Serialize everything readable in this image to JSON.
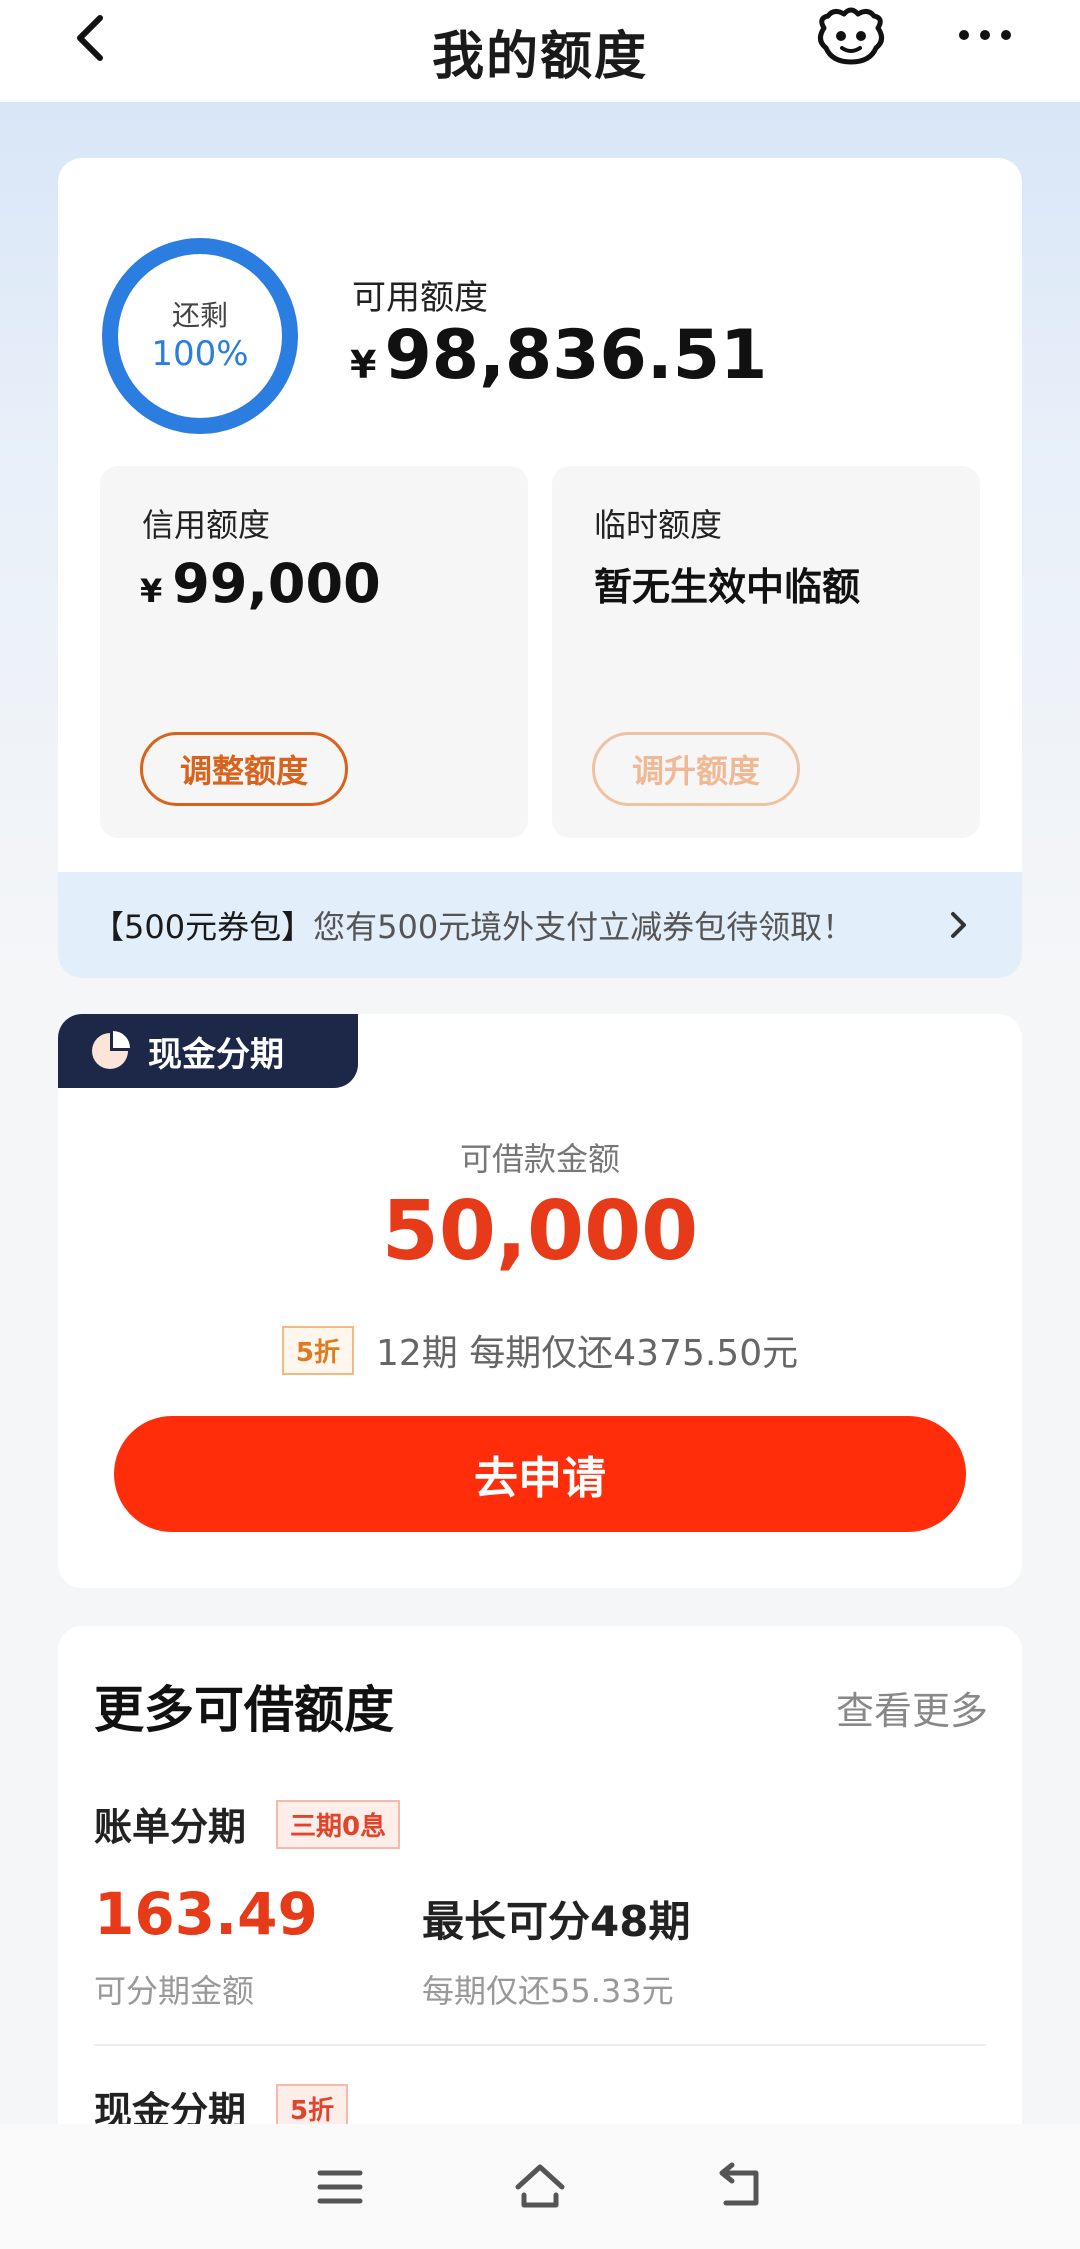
{
  "header": {
    "title": "我的额度"
  },
  "quota": {
    "ring_label": "还剩",
    "ring_value": "100%",
    "remaining_fraction": 1.0,
    "available_label": "可用额度",
    "currency": "¥",
    "available_amount": "98,836.51",
    "credit": {
      "label": "信用额度",
      "amount": "99,000",
      "button": "调整额度"
    },
    "temporary": {
      "label": "临时额度",
      "note": "暂无生效中临额",
      "button": "调升额度"
    },
    "promo": {
      "bold": "【500元券包】",
      "text": "您有500元境外支付立减券包待领取！"
    }
  },
  "cash_installment": {
    "tab_label": "现金分期",
    "loan_label": "可借款金额",
    "loan_amount": "50,000",
    "discount_badge": "5折",
    "plan_text": "12期  每期仅还4375.50元",
    "apply_button": "去申请"
  },
  "more_quota": {
    "title": "更多可借额度",
    "view_more": "查看更多",
    "items": [
      {
        "title": "账单分期",
        "tag": "三期0息",
        "amount": "163.49",
        "amount_label": "可分期金额",
        "max_periods": "最长可分48期",
        "per_period": "每期仅还55.33元"
      },
      {
        "title": "现金分期",
        "tag": "5折"
      }
    ]
  },
  "colors": {
    "accent_red": "#e63a18",
    "apply_button": "#ff2d0a",
    "ring_blue": "#2b7de0",
    "tab_navy": "#1d2748"
  },
  "icons": [
    "back-arrow-icon",
    "robot-service-icon",
    "more-dots-icon",
    "pie-chart-icon",
    "chevron-right-icon",
    "menu-icon",
    "home-icon",
    "return-icon"
  ]
}
